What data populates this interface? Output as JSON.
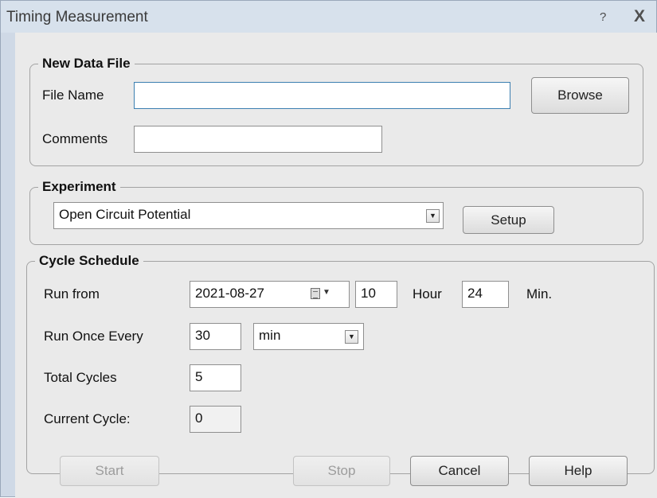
{
  "window": {
    "title": "Timing Measurement",
    "help_glyph": "?",
    "close_glyph": "X"
  },
  "new_data_file": {
    "legend": "New Data File",
    "file_name_label": "File Name",
    "file_name_value": "",
    "browse_label": "Browse",
    "comments_label": "Comments",
    "comments_value": ""
  },
  "experiment": {
    "legend": "Experiment",
    "selected": "Open Circuit Potential",
    "setup_label": "Setup"
  },
  "cycle_schedule": {
    "legend": "Cycle Schedule",
    "run_from_label": "Run from",
    "date_value": "2021-08-27",
    "hour_value": "10",
    "hour_label": "Hour",
    "min_value": "24",
    "min_label": "Min.",
    "run_once_every_label": "Run Once Every",
    "interval_value": "30",
    "interval_unit": "min",
    "total_cycles_label": "Total Cycles",
    "total_cycles_value": "5",
    "current_cycle_label": "Current Cycle:",
    "current_cycle_value": "0"
  },
  "buttons": {
    "start": "Start",
    "stop": "Stop",
    "cancel": "Cancel",
    "help": "Help"
  },
  "icons": {
    "dropdown": "chevron-down-icon",
    "calendar": "calendar-icon"
  }
}
